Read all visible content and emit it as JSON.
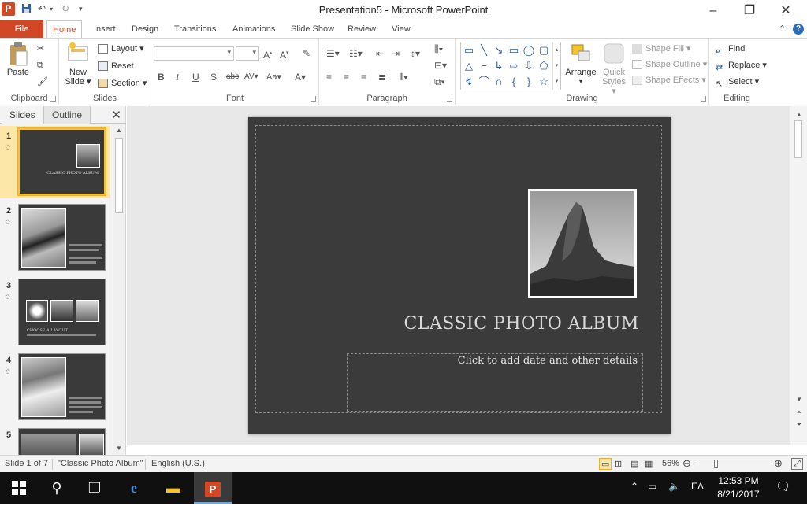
{
  "window": {
    "title": "Presentation5 - Microsoft PowerPoint",
    "app_icon_letter": "P"
  },
  "tabs": {
    "file": "File",
    "items": [
      "Home",
      "Insert",
      "Design",
      "Transitions",
      "Animations",
      "Slide Show",
      "Review",
      "View"
    ]
  },
  "ribbon": {
    "clipboard": {
      "label": "Clipboard",
      "paste": "Paste"
    },
    "slides": {
      "label": "Slides",
      "new_slide_1": "New",
      "new_slide_2": "Slide ▾",
      "layout": "Layout ▾",
      "reset": "Reset",
      "section": "Section ▾"
    },
    "font": {
      "label": "Font"
    },
    "paragraph": {
      "label": "Paragraph"
    },
    "drawing": {
      "label": "Drawing",
      "arrange": "Arrange",
      "quick_styles_1": "Quick",
      "quick_styles_2": "Styles ▾",
      "shape_fill": "Shape Fill ▾",
      "shape_outline": "Shape Outline ▾",
      "shape_effects": "Shape Effects ▾"
    },
    "editing": {
      "label": "Editing",
      "find": "Find",
      "replace": "Replace ▾",
      "select": "Select ▾"
    }
  },
  "pane": {
    "tab_slides": "Slides",
    "tab_outline": "Outline",
    "thumbnails": [
      {
        "num": "1",
        "title": "CLASSIC PHOTO ALBUM"
      },
      {
        "num": "2"
      },
      {
        "num": "3",
        "title": "CHOOSE A LAYOUT"
      },
      {
        "num": "4"
      },
      {
        "num": "5"
      }
    ]
  },
  "slide": {
    "title": "CLASSIC PHOTO ALBUM",
    "subtitle_placeholder": "Click to add date and other details"
  },
  "status": {
    "slide_info": "Slide 1 of 7",
    "theme": "\"Classic Photo Album\"",
    "language": "English (U.S.)",
    "zoom": "56%"
  },
  "taskbar": {
    "time": "12:53 PM",
    "date": "8/21/2017",
    "lang": "ΕΛ"
  }
}
